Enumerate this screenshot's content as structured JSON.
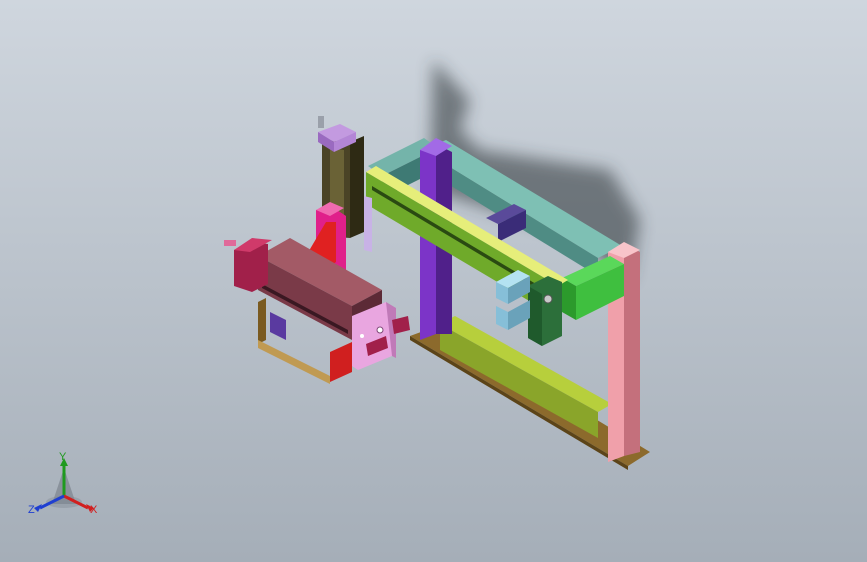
{
  "viewport": {
    "background_top": "#cfd6de",
    "background_bottom": "#a5aeb8"
  },
  "triad": {
    "x_label": "X",
    "y_label": "Y",
    "z_label": "Z",
    "x_color": "#d11f1f",
    "y_color": "#1f9a1f",
    "z_color": "#1f3fd1"
  },
  "model_colors": {
    "frame_teal": "#5f9a92",
    "frame_green": "#3fbf3f",
    "frame_pink": "#e98c98",
    "column_purple": "#6a2ca8",
    "beam_olive": "#8aa52a",
    "rail_yellow": "#e6ee7a",
    "carriage_green": "#2c6f3a",
    "slide_blue": "#86bfd8",
    "base_brown": "#8c6a2c",
    "vertical_slide": "#4a4326",
    "bracket_magenta": "#e0208a",
    "gusset_red": "#e02121",
    "block_maroon": "#7a3a48",
    "plate_lilac": "#e9a6e0",
    "cylinder_crimson": "#a1204a",
    "clamp_red": "#d01f1f",
    "clamp_brown": "#7a5a20",
    "topcap_violet": "#c39ae0"
  }
}
